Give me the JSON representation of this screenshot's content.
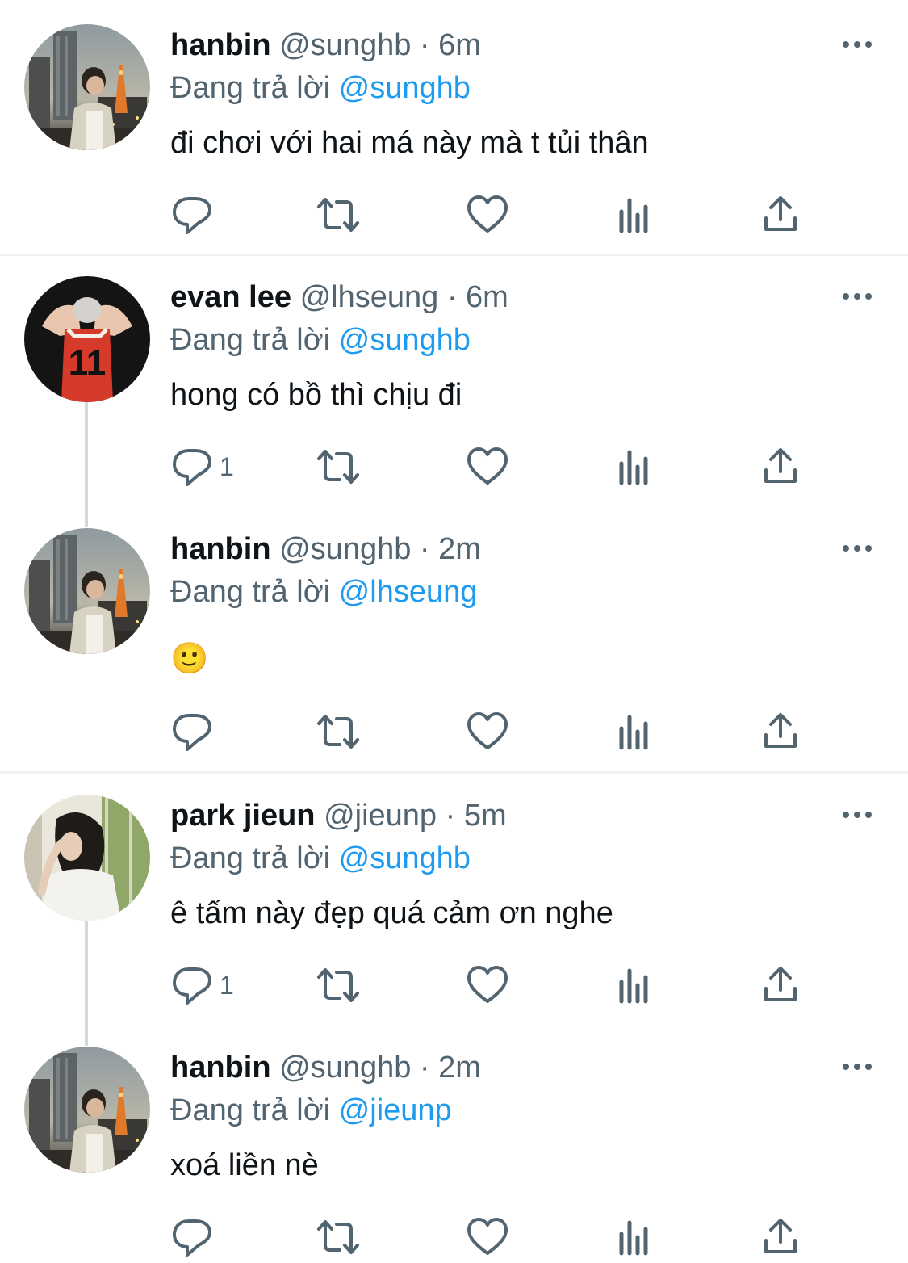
{
  "reply_prefix": "Đang trả lời",
  "dot": "·",
  "accent_color": "#1d9bf0",
  "tweets": [
    {
      "name": "hanbin",
      "handle": "@sunghb",
      "time": "6m",
      "reply_to": "@sunghb",
      "text": "đi chơi với hai má này mà t tủi thân",
      "reply_count": "",
      "avatar": "city-night-tower-avatar"
    },
    {
      "name": "evan lee",
      "handle": "@lhseung",
      "time": "6m",
      "reply_to": "@sunghb",
      "text": "hong có bồ thì chịu đi",
      "reply_count": "1",
      "avatar": "red-jersey-11-avatar"
    },
    {
      "name": "hanbin",
      "handle": "@sunghb",
      "time": "2m",
      "reply_to": "@lhseung",
      "text": "🙂",
      "reply_count": "",
      "avatar": "city-night-tower-avatar"
    },
    {
      "name": "park jieun",
      "handle": "@jieunp",
      "time": "5m",
      "reply_to": "@sunghb",
      "text": "ê tấm này đẹp quá cảm ơn nghe",
      "reply_count": "1",
      "avatar": "girl-window-avatar"
    },
    {
      "name": "hanbin",
      "handle": "@sunghb",
      "time": "2m",
      "reply_to": "@jieunp",
      "text": "xoá liền nè",
      "reply_count": "",
      "avatar": "city-night-tower-avatar"
    }
  ],
  "icons": {
    "reply": "reply-icon",
    "retweet": "retweet-icon",
    "like": "like-icon",
    "views": "views-icon",
    "share": "share-icon",
    "more": "more-icon"
  }
}
